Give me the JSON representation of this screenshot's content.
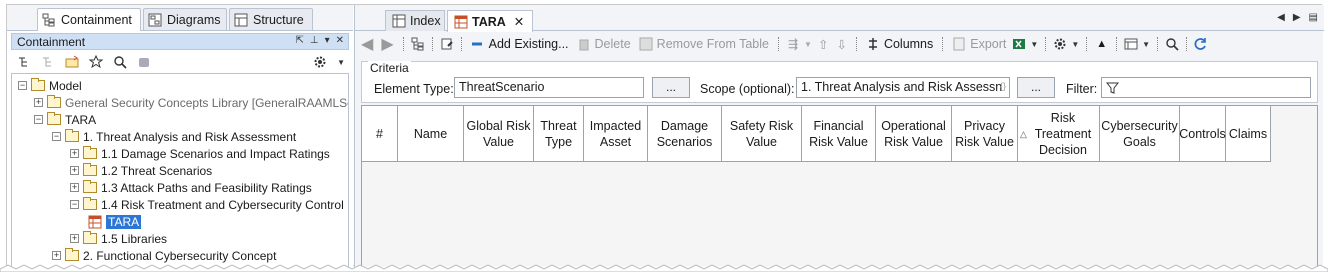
{
  "left_tabs": [
    {
      "label": "Containment"
    },
    {
      "label": "Diagrams"
    },
    {
      "label": "Structure"
    }
  ],
  "panel": {
    "title": "Containment"
  },
  "tree": [
    {
      "label": "Model",
      "level": 0
    },
    {
      "label": "General Security Concepts Library [GeneralRAAMLSe",
      "level": 1,
      "muted": true
    },
    {
      "label": "TARA",
      "level": 1
    },
    {
      "label": "1. Threat Analysis and Risk Assessment",
      "level": 2
    },
    {
      "label": "1.1 Damage Scenarios and Impact Ratings",
      "level": 3
    },
    {
      "label": "1.2 Threat Scenarios",
      "level": 3
    },
    {
      "label": "1.3 Attack Paths and Feasibility Ratings",
      "level": 3
    },
    {
      "label": "1.4 Risk Treatment and Cybersecurity Control",
      "level": 3
    },
    {
      "label": "TARA",
      "level": 4,
      "selected": true
    },
    {
      "label": "1.5 Libraries",
      "level": 3
    },
    {
      "label": "2. Functional Cybersecurity Concept",
      "level": 2
    }
  ],
  "editor_tabs": [
    {
      "label": "Index"
    },
    {
      "label": "TARA",
      "close": "✕"
    }
  ],
  "toolbar": {
    "add_existing": "Add Existing...",
    "delete": "Delete",
    "remove_from_table": "Remove From Table",
    "columns": "Columns",
    "export": "Export"
  },
  "criteria": {
    "caption": "Criteria",
    "element_type_label": "Element Type:",
    "element_type_value": "ThreatScenario",
    "browse": "...",
    "scope_label": "Scope (optional):",
    "scope_value": "1. Threat Analysis and Risk Assessn",
    "filter_label": "Filter:"
  },
  "columns": [
    "#",
    "Name",
    "Global Risk Value",
    "Threat Type",
    "Impacted Asset",
    "Damage Scenarios",
    "Safety Risk Value",
    "Financial Risk Value",
    "Operational Risk Value",
    "Privacy Risk Value",
    "Risk Treatment Decision",
    "Cybersecurity Goals",
    "Controls",
    "Claims"
  ],
  "colors": {
    "selection": "#2c77d6",
    "panel_header": "#cfe0f4",
    "chrome": "#f2f4f8"
  }
}
